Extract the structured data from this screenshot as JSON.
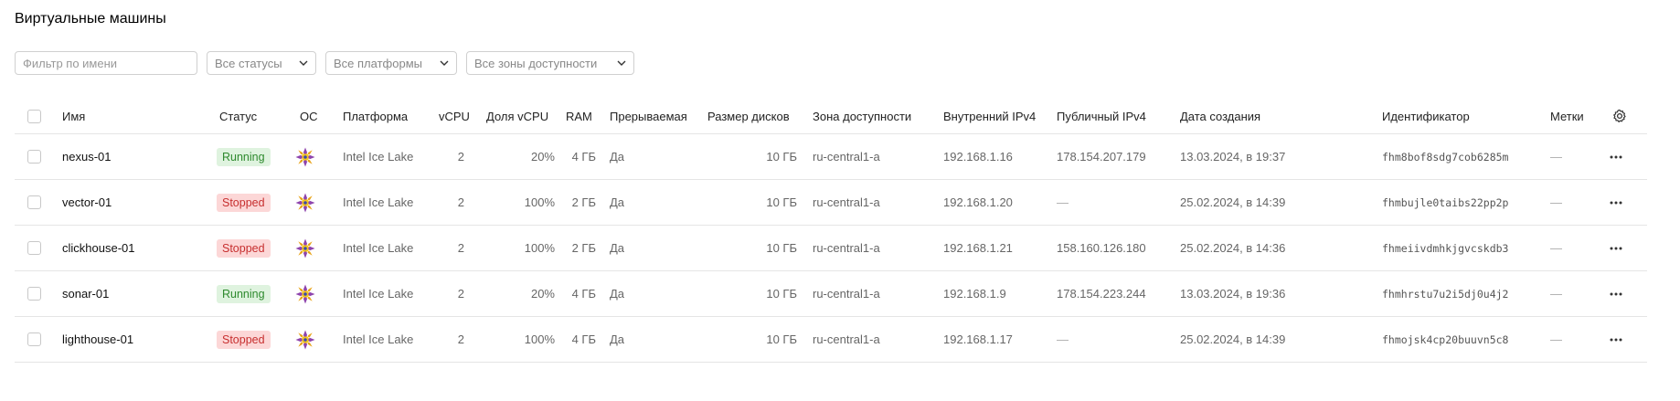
{
  "page": {
    "title": "Виртуальные машины"
  },
  "filters": {
    "name_placeholder": "Фильтр по имени",
    "status_label": "Все статусы",
    "platform_label": "Все платформы",
    "zone_label": "Все зоны доступности"
  },
  "table": {
    "headers": {
      "name": "Имя",
      "status": "Статус",
      "os": "ОС",
      "platform": "Платформа",
      "vcpu": "vCPU",
      "vcpu_share": "Доля vCPU",
      "ram": "RAM",
      "preemptible": "Прерываемая",
      "disk_size": "Размер дисков",
      "zone": "Зона доступности",
      "internal_ip": "Внутренний IPv4",
      "public_ip": "Публичный IPv4",
      "created": "Дата создания",
      "id": "Идентификатор",
      "labels": "Метки"
    },
    "rows": [
      {
        "name": "nexus-01",
        "status": "Running",
        "status_kind": "running",
        "platform": "Intel Ice Lake",
        "vcpu": "2",
        "vcpu_share": "20%",
        "ram": "4 ГБ",
        "preemptible": "Да",
        "disk_size": "10 ГБ",
        "zone": "ru-central1-a",
        "internal_ip": "192.168.1.16",
        "public_ip": "178.154.207.179",
        "created": "13.03.2024, в 19:37",
        "id": "fhm8bof8sdg7cob6285m",
        "labels": "—"
      },
      {
        "name": "vector-01",
        "status": "Stopped",
        "status_kind": "stopped",
        "platform": "Intel Ice Lake",
        "vcpu": "2",
        "vcpu_share": "100%",
        "ram": "2 ГБ",
        "preemptible": "Да",
        "disk_size": "10 ГБ",
        "zone": "ru-central1-a",
        "internal_ip": "192.168.1.20",
        "public_ip": "—",
        "created": "25.02.2024, в 14:39",
        "id": "fhmbujle0taibs22pp2p",
        "labels": "—"
      },
      {
        "name": "clickhouse-01",
        "status": "Stopped",
        "status_kind": "stopped",
        "platform": "Intel Ice Lake",
        "vcpu": "2",
        "vcpu_share": "100%",
        "ram": "2 ГБ",
        "preemptible": "Да",
        "disk_size": "10 ГБ",
        "zone": "ru-central1-a",
        "internal_ip": "192.168.1.21",
        "public_ip": "158.160.126.180",
        "created": "25.02.2024, в 14:36",
        "id": "fhmeiivdmhkjgvcskdb3",
        "labels": "—"
      },
      {
        "name": "sonar-01",
        "status": "Running",
        "status_kind": "running",
        "platform": "Intel Ice Lake",
        "vcpu": "2",
        "vcpu_share": "20%",
        "ram": "4 ГБ",
        "preemptible": "Да",
        "disk_size": "10 ГБ",
        "zone": "ru-central1-a",
        "internal_ip": "192.168.1.9",
        "public_ip": "178.154.223.244",
        "created": "13.03.2024, в 19:36",
        "id": "fhmhrstu7u2i5dj0u4j2",
        "labels": "—"
      },
      {
        "name": "lighthouse-01",
        "status": "Stopped",
        "status_kind": "stopped",
        "platform": "Intel Ice Lake",
        "vcpu": "2",
        "vcpu_share": "100%",
        "ram": "4 ГБ",
        "preemptible": "Да",
        "disk_size": "10 ГБ",
        "zone": "ru-central1-a",
        "internal_ip": "192.168.1.17",
        "public_ip": "—",
        "created": "25.02.2024, в 14:39",
        "id": "fhmojsk4cp20buuvn5c8",
        "labels": "—"
      }
    ]
  },
  "colors": {
    "running_bg": "#dff3df",
    "running_text": "#2e8a2e",
    "stopped_bg": "#fcd7d7",
    "stopped_text": "#c72f2f"
  },
  "icons": {
    "os": "linux-distro-icon",
    "row_menu": "more-horizontal-icon",
    "settings": "gear-icon",
    "dropdown": "chevron-down-icon"
  }
}
